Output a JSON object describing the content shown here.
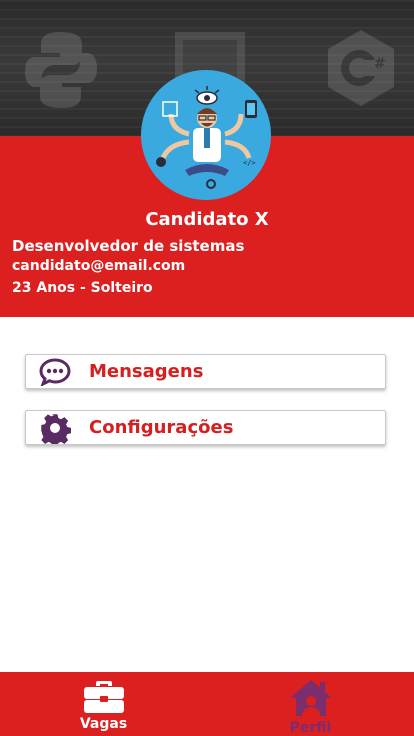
{
  "profile": {
    "name": "Candidato X",
    "role": "Desenvolvedor de sistemas",
    "email": "candidato@email.com",
    "details": "23 Anos - Solteiro"
  },
  "menu": [
    {
      "label": "Mensagens",
      "icon": "chat-bubble-icon"
    },
    {
      "label": "Configurações",
      "icon": "gear-icon"
    }
  ],
  "bottom_nav": [
    {
      "label": "Vagas",
      "icon": "briefcase-icon",
      "active": true
    },
    {
      "label": "Perfil",
      "icon": "home-user-icon",
      "active": false
    }
  ],
  "colors": {
    "primary_red": "#dc2020",
    "icon_purple": "#5a2a63",
    "avatar_blue": "#3aa9e0"
  }
}
